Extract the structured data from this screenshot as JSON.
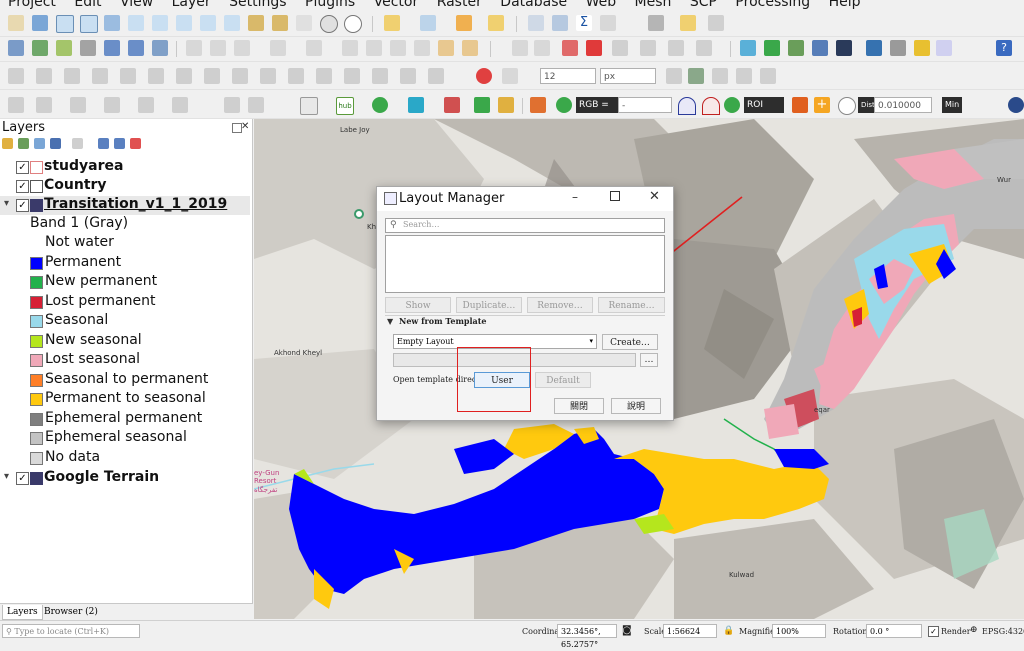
{
  "menubar": {
    "items": [
      "Project",
      "Edit",
      "View",
      "Layer",
      "Settings",
      "Plugins",
      "Vector",
      "Raster",
      "Database",
      "Web",
      "Mesh",
      "SCP",
      "Processing",
      "Help"
    ]
  },
  "toolbar": {
    "font_size_value": "12",
    "font_unit": "px",
    "rgb_label": "RGB =",
    "rgb_value": "-",
    "roi_label": "ROI",
    "dist_label": "Dist",
    "dist_value": "0.010000",
    "min_label": "Min"
  },
  "layers_panel": {
    "title": "Layers",
    "items": [
      {
        "label": "studyarea",
        "checked": "✓"
      },
      {
        "label": "Country",
        "checked": "✓"
      },
      {
        "label": "Transitation_v1_1_2019",
        "checked": "✓"
      },
      {
        "label": "Band 1 (Gray)"
      },
      {
        "label": "Not water",
        "color": "#ffffff"
      },
      {
        "label": "Permanent",
        "color": "#0000ff"
      },
      {
        "label": "New permanent",
        "color": "#22b14c"
      },
      {
        "label": "Lost permanent",
        "color": "#d62035"
      },
      {
        "label": "Seasonal",
        "color": "#99d9ea"
      },
      {
        "label": "New seasonal",
        "color": "#b5e61d"
      },
      {
        "label": "Lost seasonal",
        "color": "#f0a8b8"
      },
      {
        "label": "Seasonal to permanent",
        "color": "#ff7f27"
      },
      {
        "label": "Permanent to seasonal",
        "color": "#ffc90e"
      },
      {
        "label": "Ephemeral permanent",
        "color": "#7f7f7f"
      },
      {
        "label": "Ephemeral seasonal",
        "color": "#c3c3c3"
      },
      {
        "label": "No data",
        "color": "#d9d9d9"
      },
      {
        "label": "Google Terrain",
        "checked": "✓"
      }
    ]
  },
  "map_labels": {
    "labe_joy": "Labe Joy",
    "akhond": "Akhond Kheyl",
    "kulwad": "Kulwad",
    "kh": "Kh",
    "eqar": "eqar",
    "wur": "Wur",
    "gun": "ey-Gun",
    "resort": "Resort",
    "arabic": "تفرجگاه"
  },
  "dialog": {
    "title": "Layout Manager",
    "search_placeholder": "Search…",
    "buttons": {
      "show": "Show",
      "duplicate": "Duplicate…",
      "remove": "Remove…",
      "rename": "Rename…",
      "create": "Create…",
      "browse": "…",
      "user": "User",
      "default": "Default",
      "close": "關閉",
      "help": "說明"
    },
    "template_section": "New from Template",
    "template_select": "Empty Layout",
    "open_template_dir": "Open template directory"
  },
  "bottom_tabs": [
    "Layers",
    "Browser (2)"
  ],
  "statusbar": {
    "locate_placeholder": "Type to locate (Ctrl+K)",
    "coordinate_label": "Coordinate",
    "coordinate_value": "32.3456°, 65.2757°",
    "scale_label": "Scale",
    "scale_value": "1:56624",
    "magnifier_label": "Magnifier",
    "magnifier_value": "100%",
    "rotation_label": "Rotation",
    "rotation_value": "0.0 °",
    "render_label": "Render",
    "crs": "EPSG:4326"
  }
}
